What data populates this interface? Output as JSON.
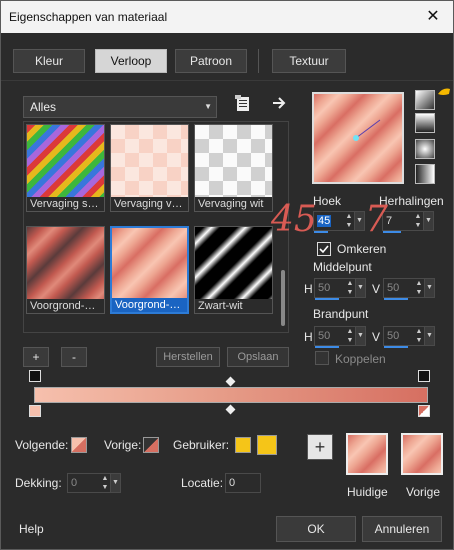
{
  "window": {
    "title": "Eigenschappen van materiaal",
    "close_glyph": "✕"
  },
  "tabs": [
    {
      "label": "Kleur"
    },
    {
      "label": "Verloop"
    },
    {
      "label": "Patroon"
    },
    {
      "label": "Textuur"
    }
  ],
  "category_select": {
    "value": "Alles"
  },
  "thumbnails": [
    {
      "label": "Vervaging s…"
    },
    {
      "label": "Vervaging v…"
    },
    {
      "label": "Vervaging wit"
    },
    {
      "label": "Voorgrond-…"
    },
    {
      "label": "Voorgrond-…"
    },
    {
      "label": "Zwart-wit"
    }
  ],
  "list_buttons": {
    "add": "+",
    "remove": "-",
    "restore": "Herstellen",
    "save": "Opslaan"
  },
  "angle": {
    "label": "Hoek",
    "value": "45"
  },
  "repeats": {
    "label": "Herhalingen",
    "value": "7"
  },
  "annotations": {
    "angle_note": "45",
    "repeats_note": "7"
  },
  "invert": {
    "label": "Omkeren",
    "checked": true
  },
  "center": {
    "label": "Middelpunt",
    "h_label": "H",
    "h_value": "50",
    "v_label": "V",
    "v_value": "50"
  },
  "focal": {
    "label": "Brandpunt",
    "h_label": "H",
    "h_value": "50",
    "v_label": "V",
    "v_value": "50"
  },
  "link": {
    "label": "Koppelen",
    "checked": false
  },
  "bottom": {
    "next_label": "Volgende:",
    "prev_label": "Vorige:",
    "user_label": "Gebruiker:",
    "opacity_label": "Dekking:",
    "opacity_value": "0",
    "location_label": "Locatie:",
    "location_value": "0",
    "plus": "+",
    "current_label": "Huidige",
    "previous_label": "Vorige"
  },
  "footer": {
    "help": "Help",
    "ok": "OK",
    "cancel": "Annuleren"
  },
  "colors": {
    "accent": "#2d7bd6",
    "gradient_start": "#f6c0ad",
    "gradient_end": "#d66f61",
    "user_yellow": "#f5c518",
    "annotation_red": "#d85b54"
  }
}
